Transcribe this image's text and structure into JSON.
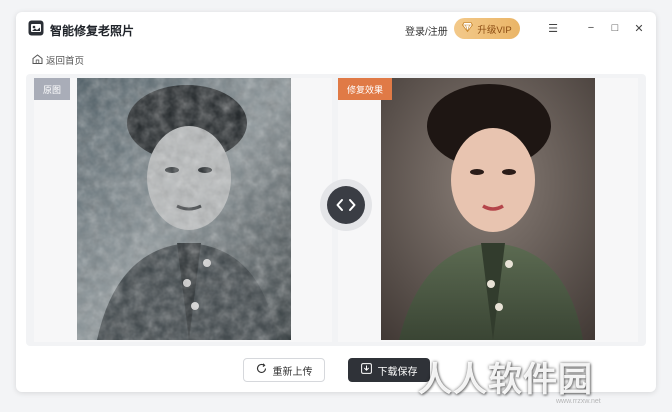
{
  "app": {
    "title": "智能修复老照片"
  },
  "header": {
    "login_label": "登录/注册",
    "vip_label": "升级VIP"
  },
  "window_controls": {
    "menu": "☰",
    "minimize": "−",
    "maximize": "□",
    "close": "✕"
  },
  "nav": {
    "back_label": "返回首页"
  },
  "panels": {
    "original_tag": "原图",
    "restored_tag": "修复效果"
  },
  "footer": {
    "reupload_label": "重新上传",
    "download_label": "下载保存"
  },
  "watermark": {
    "text": "人人软件园",
    "sub": "www.rrzxw.net"
  },
  "colors": {
    "vip_gold": "#eab567",
    "tag_orange": "#e07a46",
    "tag_gray": "#a9adb8",
    "dark_button": "#2f3238"
  },
  "icons": [
    "app-logo-icon",
    "vip-diamond-icon",
    "menu-icon",
    "minimize-icon",
    "maximize-icon",
    "close-icon",
    "home-icon",
    "swap-arrows-icon",
    "refresh-icon",
    "download-icon"
  ]
}
